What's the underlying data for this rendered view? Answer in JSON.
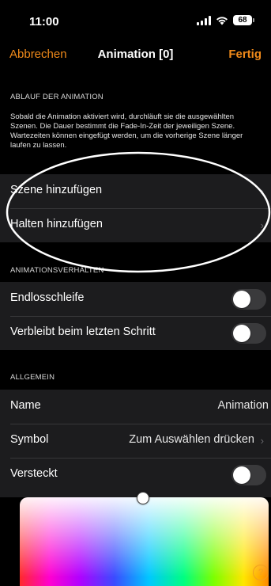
{
  "status_bar": {
    "time": "11:00",
    "battery": "68"
  },
  "nav": {
    "cancel": "Abbrechen",
    "title": "Animation [0]",
    "done": "Fertig"
  },
  "sequence": {
    "header": "ABLAUF DER ANIMATION",
    "description": "Sobald die Animation aktiviert wird, durchläuft sie die ausgewählten Szenen. Die Dauer bestimmt die Fade-In-Zeit der jeweiligen Szene. Wartezeiten können eingefügt werden, um die vorherige Szene länger laufen zu lassen.",
    "add_scene": "Szene hinzufügen",
    "add_hold": "Halten hinzufügen"
  },
  "behavior": {
    "header": "ANIMATIONSVERHALTEN",
    "loop_label": "Endlosschleife",
    "loop_on": false,
    "stay_label": "Verbleibt beim letzten Schritt",
    "stay_on": false
  },
  "general": {
    "header": "ALLGEMEIN",
    "name_label": "Name",
    "name_value": "Animation",
    "symbol_label": "Symbol",
    "symbol_value": "Zum Auswählen drücken",
    "hidden_label": "Versteckt",
    "hidden_on": false
  },
  "icons": {
    "chevron": "chevron-right-icon",
    "help": "help-icon"
  },
  "colors": {
    "accent": "#f08a1a",
    "background": "#000000",
    "cell": "#1c1c1e",
    "toggle_off": "#3a3a3c"
  }
}
